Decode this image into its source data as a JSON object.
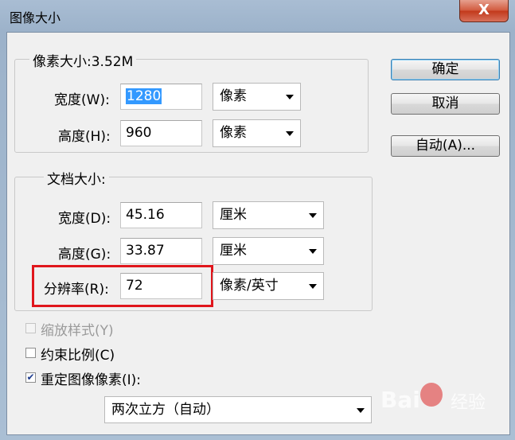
{
  "window": {
    "title": "图像大小",
    "close_glyph": "X"
  },
  "pixel_dimensions": {
    "legend": "像素大小:3.52M",
    "width": {
      "label": "宽度(W):",
      "value": "1280",
      "unit": "像素"
    },
    "height": {
      "label": "高度(H):",
      "value": "960",
      "unit": "像素"
    }
  },
  "document_size": {
    "legend": "文档大小:",
    "width": {
      "label": "宽度(D):",
      "value": "45.16",
      "unit": "厘米"
    },
    "height": {
      "label": "高度(G):",
      "value": "33.87",
      "unit": "厘米"
    },
    "resolution": {
      "label": "分辨率(R):",
      "value": "72",
      "unit": "像素/英寸"
    }
  },
  "buttons": {
    "ok": "确定",
    "cancel": "取消",
    "auto": "自动(A)..."
  },
  "options": {
    "scale_styles": {
      "label": "缩放样式(Y)",
      "checked": false,
      "enabled": false
    },
    "constrain_proportions": {
      "label": "约束比例(C)",
      "checked": false,
      "enabled": true
    },
    "resample_image": {
      "label": "重定图像像素(I):",
      "checked": true,
      "enabled": true
    },
    "resample_method": "两次立方（自动）"
  },
  "watermark": {
    "left": "Bai",
    "right": "经验"
  },
  "colors": {
    "highlight_box": "#e0161c",
    "selection": "#3399ff"
  }
}
